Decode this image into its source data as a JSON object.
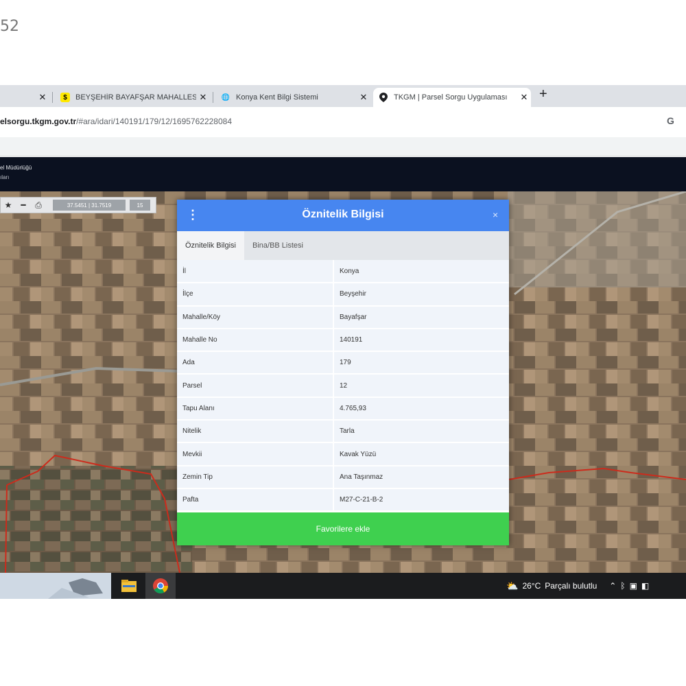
{
  "corner_text": "52",
  "browser": {
    "tabs": [
      {
        "title": "",
        "icon": "page-icon"
      },
      {
        "title": "BEYŞEHİR BAYAFŞAR MAHALLESİ",
        "icon": "sahibinden-icon"
      },
      {
        "title": "Konya Kent Bilgi Sistemi",
        "icon": "globe-icon"
      },
      {
        "title": "TKGM | Parsel Sorgu Uygulaması",
        "icon": "map-pin-icon"
      }
    ],
    "new_tab": "+",
    "url_domain": "elsorgu.tkgm.gov.tr",
    "url_path": "/#ara/idari/140191/179/12/1695762228084",
    "google_icon": "G"
  },
  "app_header": {
    "line1": "el Müdürlüğü",
    "line2": "ıları"
  },
  "map_toolbar": {
    "coordinates": "37.5451 | 31.7519",
    "zoom": "15"
  },
  "dialog": {
    "title": "Öznitelik Bilgisi",
    "close": "×",
    "tabs": [
      "Öznitelik Bilgisi",
      "Bina/BB Listesi"
    ],
    "rows": [
      {
        "key": "İl",
        "value": "Konya"
      },
      {
        "key": "İlçe",
        "value": "Beyşehir"
      },
      {
        "key": "Mahalle/Köy",
        "value": "Bayafşar"
      },
      {
        "key": "Mahalle No",
        "value": "140191"
      },
      {
        "key": "Ada",
        "value": "179"
      },
      {
        "key": "Parsel",
        "value": "12"
      },
      {
        "key": "Tapu Alanı",
        "value": "4.765,93"
      },
      {
        "key": "Nitelik",
        "value": "Tarla"
      },
      {
        "key": "Mevkii",
        "value": "Kavak Yüzü"
      },
      {
        "key": "Zemin Tip",
        "value": "Ana Taşınmaz"
      },
      {
        "key": "Pafta",
        "value": "M27-C-21-B-2"
      }
    ],
    "favorite_button": "Favorilere ekle"
  },
  "taskbar": {
    "temperature": "26°C",
    "weather": "Parçalı bulutlu"
  },
  "colors": {
    "dialog_header": "#4786f0",
    "favorite_button": "#3fd04f",
    "parcel_boundary": "#cc2b1c"
  }
}
